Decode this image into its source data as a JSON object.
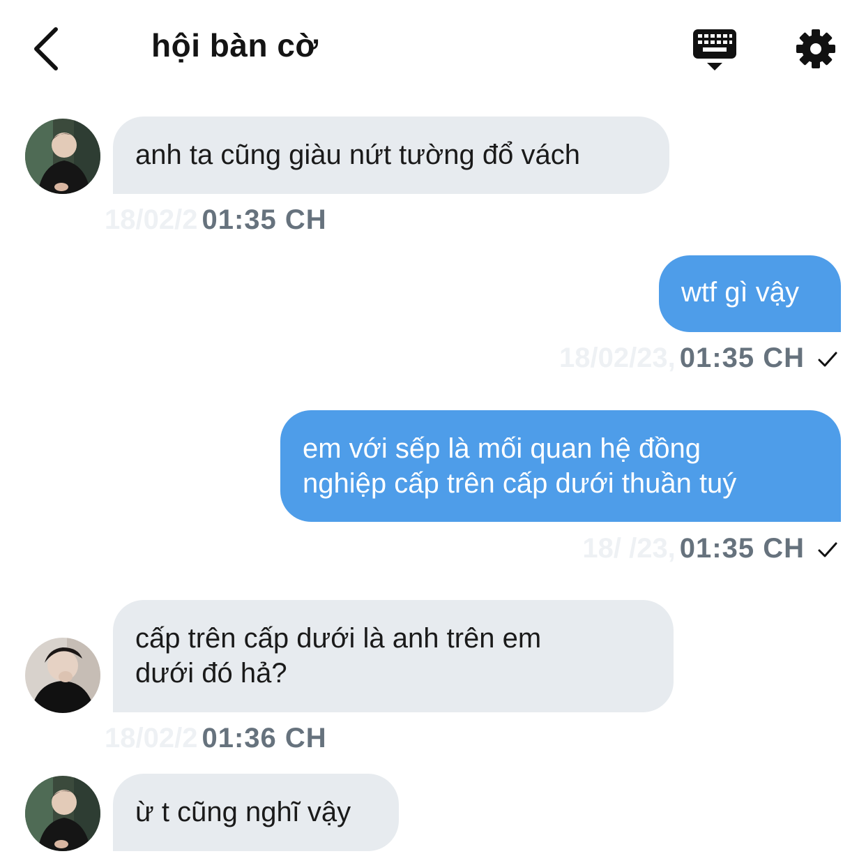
{
  "header": {
    "title": "hội bàn cờ",
    "back_icon": "chevron-left-icon",
    "keyboard_icon": "keyboard-icon",
    "settings_icon": "gear-icon"
  },
  "colors": {
    "incoming_bubble": "#e7ebef",
    "outgoing_bubble": "#4e9de9",
    "timestamp": "#66727d"
  },
  "messages": [
    {
      "direction": "incoming",
      "lines": [
        "anh ta cũng giàu nứt tường đổ vách"
      ],
      "date": "18/02/2",
      "time": "01:35 CH"
    },
    {
      "direction": "outgoing",
      "lines": [
        "wtf gì vậy"
      ],
      "date": "18/02/23,",
      "time": "01:35 CH",
      "status": "sent"
    },
    {
      "direction": "outgoing",
      "lines": [
        "em với sếp là mối quan hệ đồng",
        "nghiệp cấp trên cấp dưới thuần tuý"
      ],
      "date": "18/  /23,",
      "time": "01:35 CH",
      "status": "sent"
    },
    {
      "direction": "incoming",
      "lines": [
        "cấp trên cấp dưới là anh trên em",
        "dưới đó hả?"
      ],
      "date": "18/02/2",
      "time": "01:36 CH"
    },
    {
      "direction": "incoming",
      "lines": [
        "ừ t cũng nghĩ vậy"
      ]
    }
  ]
}
